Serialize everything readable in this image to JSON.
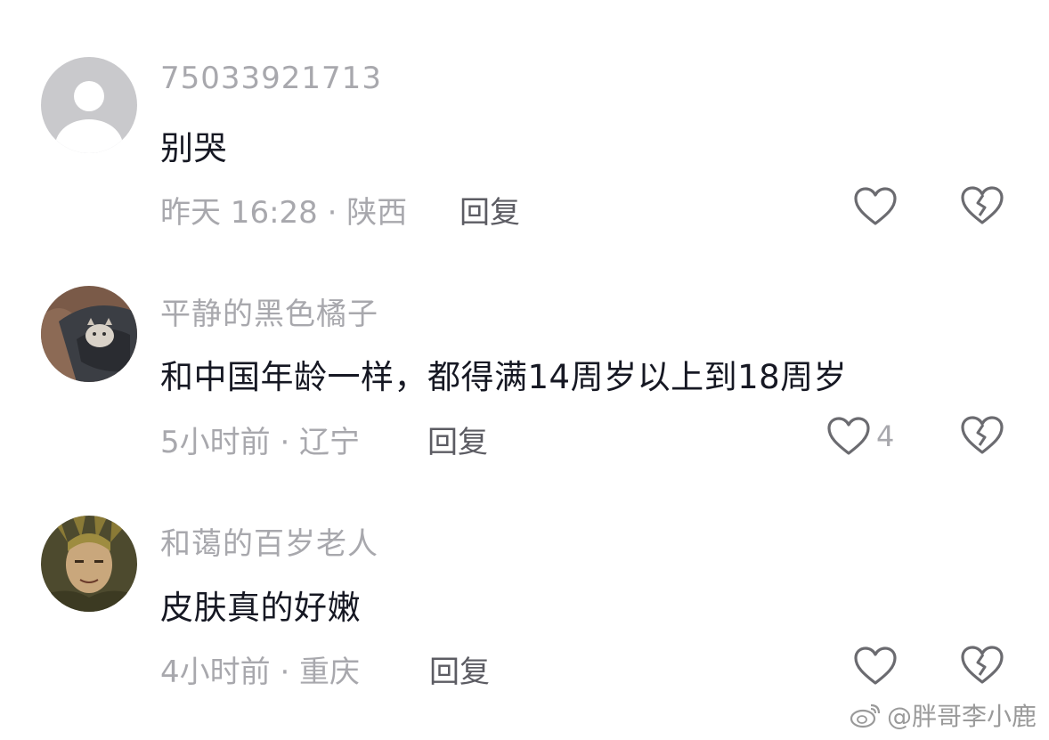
{
  "comments": [
    {
      "username": "75033921713",
      "avatar": "default-avatar-icon",
      "text": "别哭",
      "meta": "昨天 16:28 · 陕西",
      "reply_label": "回复",
      "like_count": "",
      "like_icon": "heart-outline-icon",
      "dislike_icon": "broken-heart-icon"
    },
    {
      "username": "平静的黑色橘子",
      "avatar": "photo-avatar-cat",
      "text": "和中国年龄一样，都得满14周岁以上到18周岁",
      "meta": "5小时前 · 辽宁",
      "reply_label": "回复",
      "like_count": "4",
      "like_icon": "heart-outline-icon",
      "dislike_icon": "broken-heart-icon"
    },
    {
      "username": "和蔼的百岁老人",
      "avatar": "photo-avatar-anime-character",
      "text": "皮肤真的好嫩",
      "meta": "4小时前 · 重庆",
      "reply_label": "回复",
      "like_count": "",
      "like_icon": "heart-outline-icon",
      "dislike_icon": "broken-heart-icon"
    }
  ],
  "watermark": {
    "text": "@胖哥李小鹿",
    "icon": "weibo-logo-icon"
  },
  "colors": {
    "text_primary": "#161823",
    "text_secondary": "#a8a8ad",
    "reply": "#5c5c63",
    "icon": "#6b6b70"
  }
}
